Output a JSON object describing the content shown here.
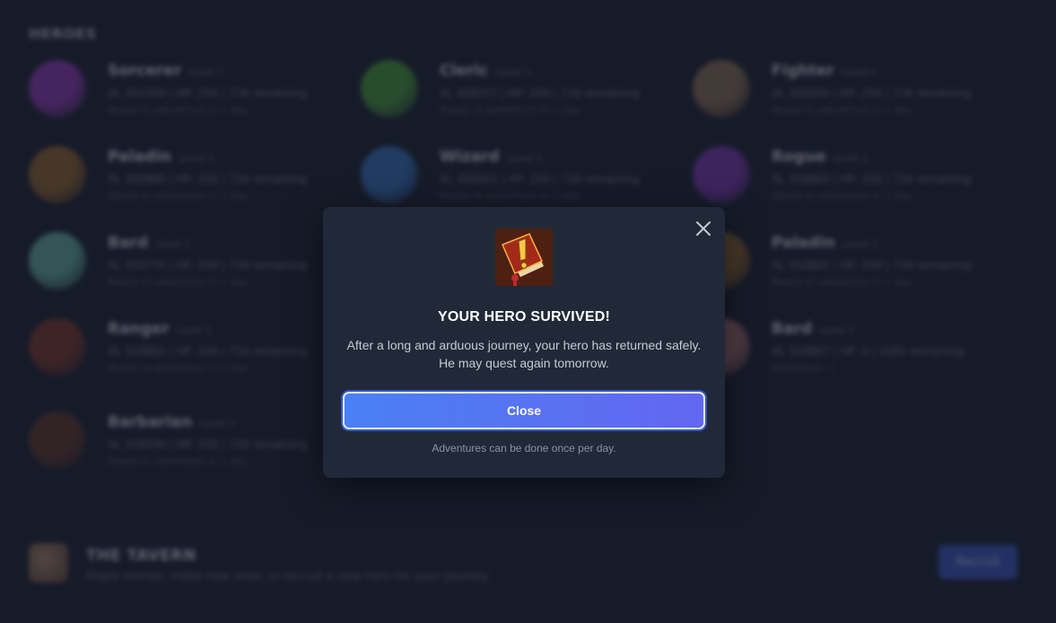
{
  "colors": {
    "background": "#1b2130",
    "modal_bg": "#212938",
    "button_gradient_start": "#4a80f5",
    "button_gradient_end": "#6366f1"
  },
  "background": {
    "section_title": "HEROES",
    "heroes": [
      {
        "name": "Sorcerer",
        "level": "Level 1",
        "stats": "XL 301500 | HP: 250 | 716 remaining",
        "status": "Ready to adventure in 1 day",
        "portrait_color": "#a23cc9"
      },
      {
        "name": "Cleric",
        "level": "Level 1",
        "stats": "XL 300217 | HP: 250 | 716 remaining",
        "status": "Ready to adventure in 1 day",
        "portrait_color": "#4fae3c"
      },
      {
        "name": "Fighter",
        "level": "Level 1",
        "stats": "XL 300200 | HP: 250 | 716 remaining",
        "status": "Ready to adventure in 1 day",
        "portrait_color": "#9a7a5a"
      },
      {
        "name": "Paladin",
        "level": "Level 1",
        "stats": "XL 300900 | HP: 250 | 716 remaining",
        "status": "Ready to adventure in 1 day",
        "portrait_color": "#a5702e"
      },
      {
        "name": "Wizard",
        "level": "Level 1",
        "stats": "XL 300603 | HP: 250 | 716 remaining",
        "status": "Ready to adventure in 1 day",
        "portrait_color": "#3a7ed0"
      },
      {
        "name": "Rogue",
        "level": "Level 1",
        "stats": "XL 310603 | HP: 250 | 716 remaining",
        "status": "Ready to adventure in 1 day",
        "portrait_color": "#8a3ac7"
      },
      {
        "name": "Bard",
        "level": "Level 1",
        "stats": "XL 310770 | HP: 250 | 716 remaining",
        "status": "Ready to adventure in 1 day",
        "portrait_color": "#6cc4b0"
      },
      {
        "name": "Paladin",
        "level": "Level 1",
        "stats": "XL 310801 | HP: 250 | 716 remaining",
        "status": "Ready to adventure in 1 day",
        "portrait_color": "#a5702e"
      },
      {
        "name": "Ranger",
        "level": "Level 1",
        "stats": "XL 310882 | HP: 250 | 716 remaining",
        "status": "Ready to adventure in 1 day",
        "portrait_color": "#8a3a2a"
      },
      {
        "name": "Bard",
        "level": "Level 1",
        "stats": "XL 310887 | HP: 0 | 1082 remaining",
        "status": "Adventure →",
        "portrait_color": "#c07a7a"
      },
      {
        "name": "Barbarian",
        "level": "Level 1",
        "stats": "XL 310939 | HP: 250 | 716 remaining",
        "status": "Ready to adventure in 1 day",
        "portrait_color": "#6a3a2a"
      }
    ],
    "tavern": {
      "title": "THE TAVERN",
      "subtitle": "Share stories, make new ones, or recruit a new hero for your journey.",
      "recruit_label": "Recruit"
    }
  },
  "modal": {
    "close_icon": "close-icon",
    "icon": "warning-book-icon",
    "title": "YOUR HERO SURVIVED!",
    "body": "After a long and arduous journey, your hero has returned safely. He may quest again tomorrow.",
    "button_label": "Close",
    "note": "Adventures can be done once per day."
  }
}
